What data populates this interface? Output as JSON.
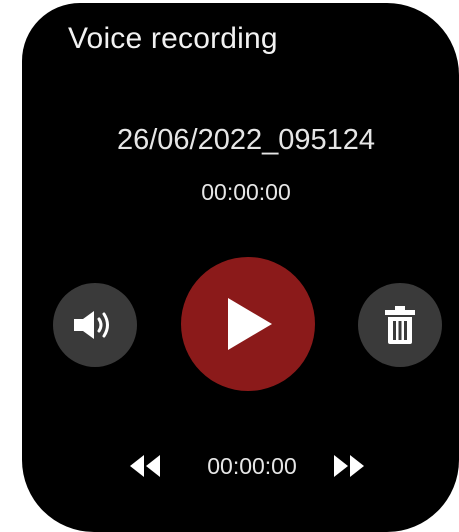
{
  "app": {
    "title": "Voice recording"
  },
  "recording": {
    "filename": "26/06/2022_095124",
    "elapsed": "00:00:00",
    "position": "00:00:00"
  },
  "controls": {
    "volume_icon": "speaker-icon",
    "play_icon": "play-icon",
    "delete_icon": "trash-icon",
    "rewind_icon": "rewind-icon",
    "fastforward_icon": "fast-forward-icon"
  },
  "colors": {
    "background": "#000000",
    "play_button": "#8b1a1a",
    "side_button": "#3a3a3a",
    "text": "#e6e6e6"
  }
}
